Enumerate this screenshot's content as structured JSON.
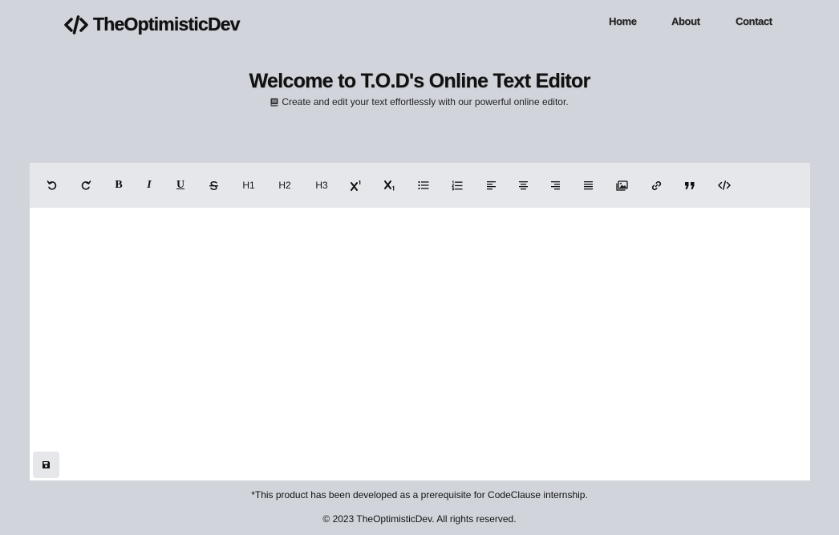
{
  "navbar": {
    "brand": "TheOptimisticDev",
    "brand_icon": "code-icon",
    "links": {
      "home": "Home",
      "about": "About",
      "contact": "Contact"
    }
  },
  "hero": {
    "title": "Welcome to T.O.D's Online Text Editor",
    "subtitle": "Create and edit your text effortlessly with our powerful online editor.",
    "subtitle_icon": "book-icon"
  },
  "toolbar": {
    "undo_icon": "undo-icon",
    "redo_icon": "redo-icon",
    "bold_label": "B",
    "italic_label": "I",
    "underline_label": "U",
    "strikethrough_icon": "strikethrough-icon",
    "h1_label": "H1",
    "h2_label": "H2",
    "h3_label": "H3",
    "superscript_icon": "superscript-icon",
    "subscript_icon": "subscript-icon",
    "unordered_list_icon": "unordered-list-icon",
    "ordered_list_icon": "ordered-list-icon",
    "align_left_icon": "align-left-icon",
    "align_center_icon": "align-center-icon",
    "align_right_icon": "align-right-icon",
    "align_justify_icon": "align-justify-icon",
    "image_icon": "image-icon",
    "link_icon": "link-icon",
    "quote_icon": "quote-icon",
    "code_icon": "code-icon"
  },
  "editor": {
    "content": "",
    "save_icon": "save-icon"
  },
  "footer": {
    "note": "*This product has been developed as a prerequisite for CodeClause internship.",
    "copyright": "© 2023 TheOptimisticDev. All rights reserved."
  },
  "colors": {
    "page_background": "#d1d5db",
    "toolbar_background": "#e5e7eb",
    "editor_background": "#ffffff",
    "text": "#111111"
  }
}
